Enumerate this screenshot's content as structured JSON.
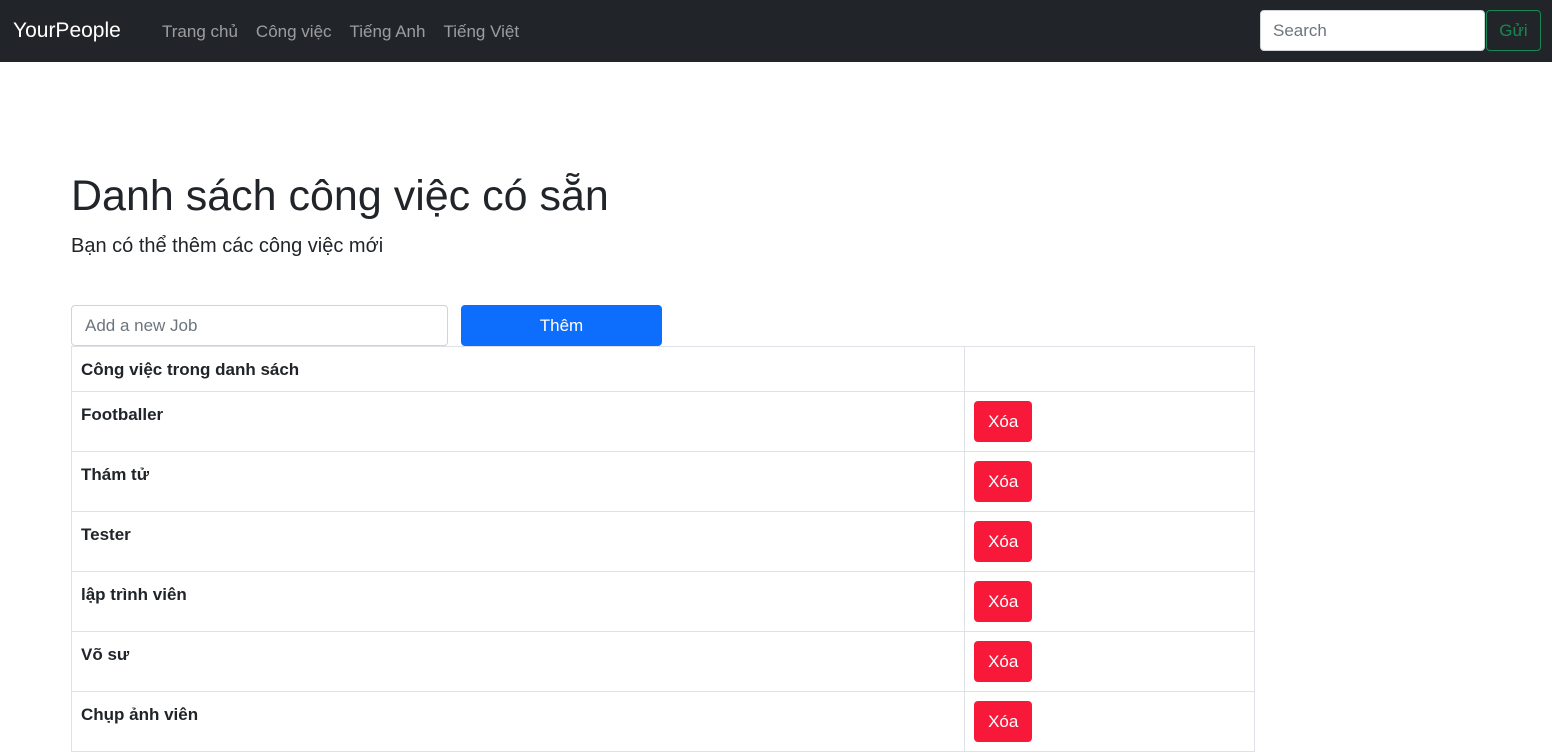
{
  "navbar": {
    "brand": "YourPeople",
    "links": [
      {
        "label": "Trang chủ"
      },
      {
        "label": "Công việc"
      },
      {
        "label": "Tiếng Anh"
      },
      {
        "label": "Tiếng Việt"
      }
    ],
    "search": {
      "placeholder": "Search",
      "value": "",
      "button_label": "Gửi"
    }
  },
  "main": {
    "title": "Danh sách công việc có sẵn",
    "lead": "Bạn có thể thêm các công việc mới",
    "add_form": {
      "placeholder": "Add a new Job",
      "value": "",
      "button_label": "Thêm"
    },
    "table": {
      "header": "Công việc trong danh sách",
      "delete_label": "Xóa",
      "rows": [
        {
          "name": "Footballer"
        },
        {
          "name": "Thám tử"
        },
        {
          "name": "Tester"
        },
        {
          "name": "lập trình viên"
        },
        {
          "name": "Võ sư"
        },
        {
          "name": "Chụp ảnh viên"
        }
      ]
    }
  },
  "colors": {
    "navbar_bg": "#212529",
    "primary": "#0d6efd",
    "danger": "#f8193a",
    "success_outline": "#198754"
  }
}
